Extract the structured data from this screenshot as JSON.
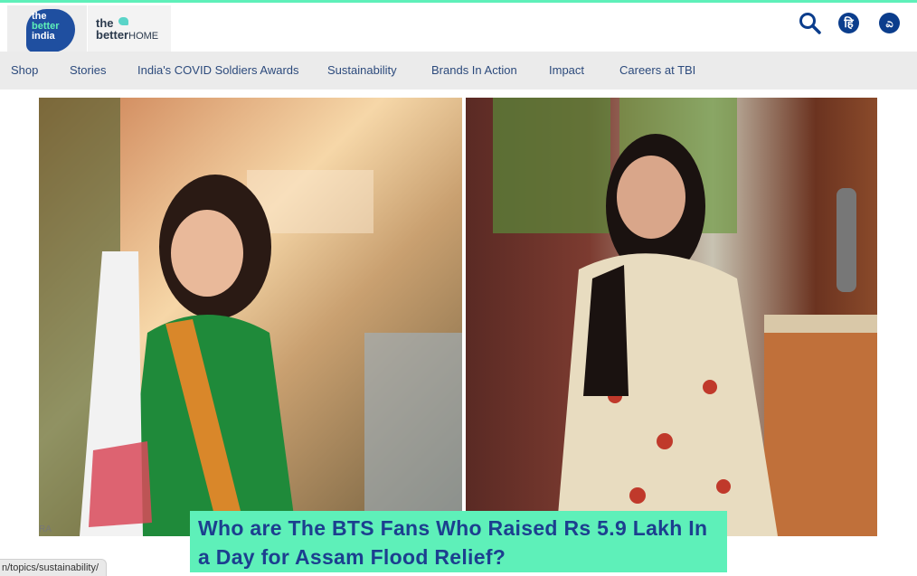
{
  "brand": {
    "logo_primary_lines": [
      "the",
      "better",
      "india"
    ],
    "logo_secondary": {
      "word1": "the",
      "word2": "better",
      "word3": "HOME"
    }
  },
  "header": {
    "icons": [
      "search-icon",
      "hindi-language-icon",
      "kannada-language-icon"
    ],
    "hindi_glyph": "हि",
    "kannada_glyph": "ಎ"
  },
  "nav": {
    "items": [
      {
        "label": "Shop"
      },
      {
        "label": "Stories"
      },
      {
        "label": "India's COVID Soldiers Awards"
      },
      {
        "label": "Sustainability"
      },
      {
        "label": "Brands In Action"
      },
      {
        "label": "Impact"
      },
      {
        "label": "Careers at TBI"
      }
    ]
  },
  "article": {
    "headline": "Who are The BTS Fans Who Raised Rs 5.9 Lakh In a Day for Assam Flood Relief?",
    "image_credit": "RA"
  },
  "status_bar": {
    "url": "n/topics/sustainability/"
  },
  "colors": {
    "accent_green": "#5ef0b9",
    "brand_blue": "#1f4fa0",
    "headline_blue": "#1c3f8f",
    "nav_bg": "#ebebeb"
  }
}
